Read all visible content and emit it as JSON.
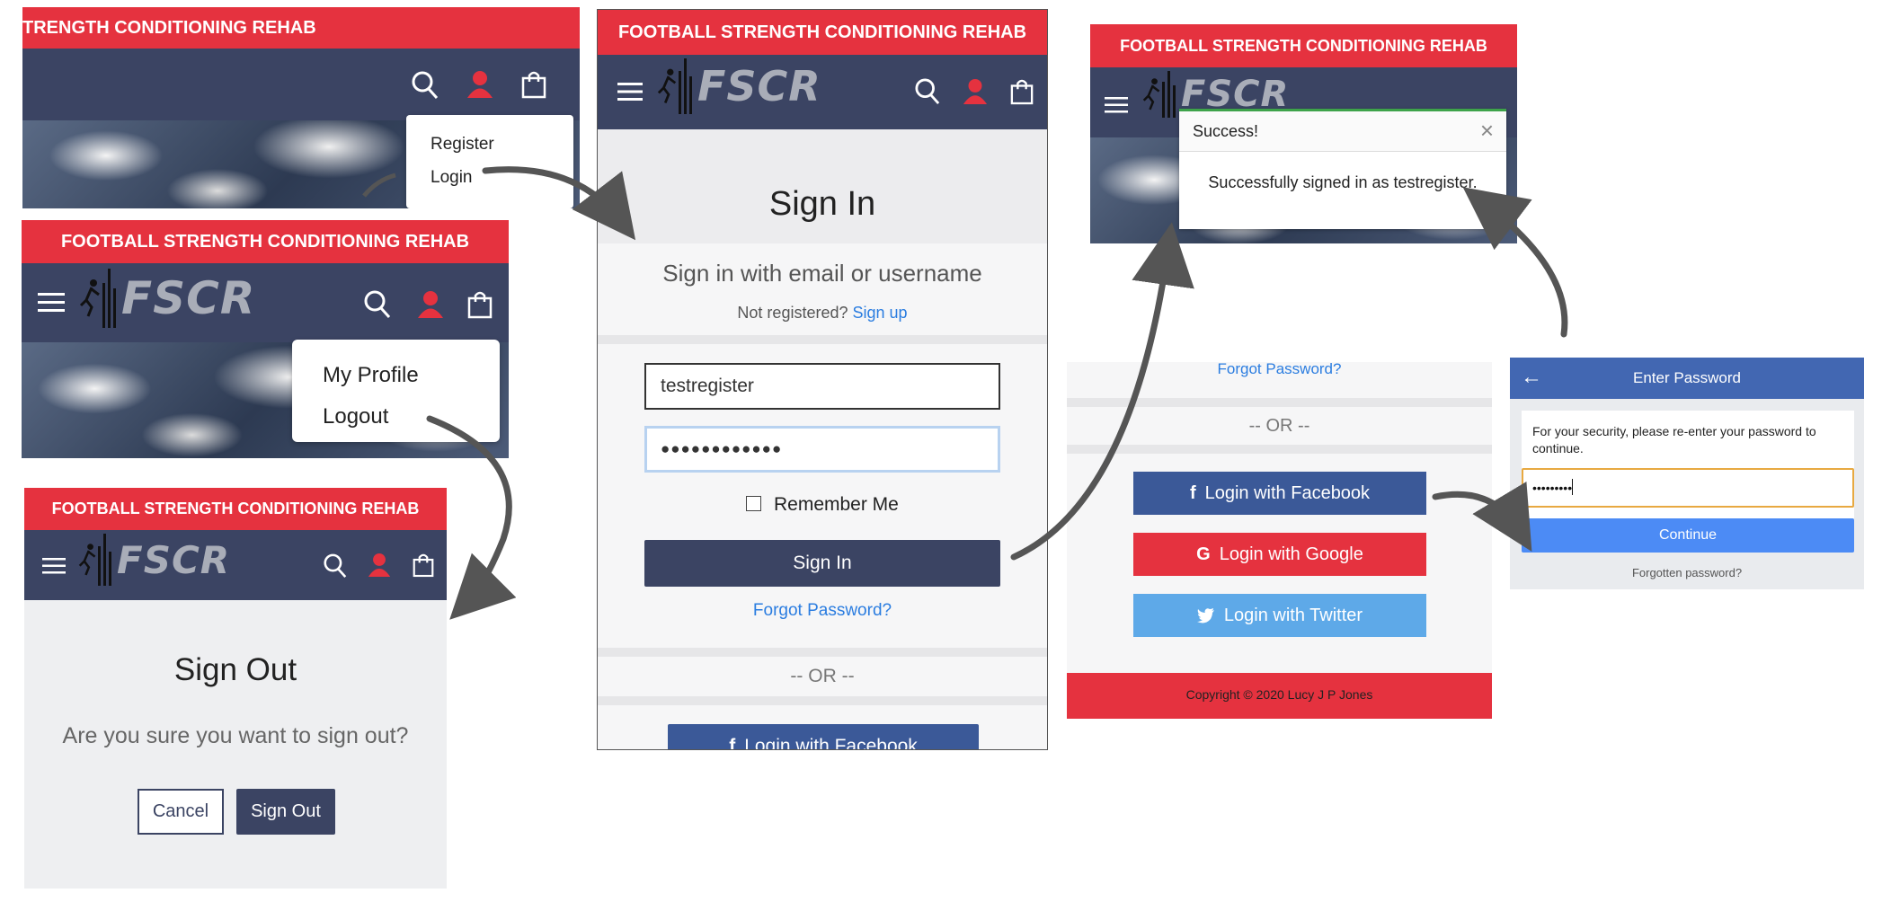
{
  "brand": {
    "banner_text": "FOOTBALL STRENGTH CONDITIONING REHAB",
    "banner_text_cropped": "TRENGTH CONDITIONING REHAB",
    "logo_text": "FSCR",
    "colors": {
      "red": "#e5323f",
      "navy": "#3b4463",
      "link": "#2b7de0",
      "facebook": "#3b5998",
      "twitter": "#5ea9e8"
    }
  },
  "icons": {
    "menu": "hamburger-icon",
    "search": "search-icon",
    "user": "user-icon",
    "bag": "shopping-bag-icon",
    "close": "close-icon",
    "back": "back-arrow-icon",
    "facebook": "facebook-icon",
    "google": "google-icon",
    "twitter": "twitter-icon"
  },
  "panel_account_menu": {
    "items": [
      "Register",
      "Login"
    ]
  },
  "panel_profile_menu": {
    "items": [
      "My Profile",
      "Logout"
    ]
  },
  "panel_signout": {
    "title": "Sign Out",
    "question": "Are you sure you want to sign out?",
    "cancel": "Cancel",
    "confirm": "Sign Out"
  },
  "panel_signin": {
    "title": "Sign In",
    "subtitle": "Sign in with email or username",
    "not_registered": "Not registered?",
    "signup": "Sign up",
    "username_value": "testregister",
    "password_value": "●●●●●●●●●●●●",
    "remember": "Remember Me",
    "submit": "Sign In",
    "forgot": "Forgot Password?",
    "or": "-- OR --",
    "facebook": "Login with Facebook"
  },
  "panel_success": {
    "heading": "Success!",
    "message": "Successfully signed in as testregister."
  },
  "panel_social": {
    "forgot": "Forgot Password?",
    "or": "-- OR --",
    "facebook": "Login with Facebook",
    "google": "Login with Google",
    "twitter": "Login with Twitter",
    "copyright": "Copyright © 2020 Lucy J P Jones"
  },
  "panel_fb_password": {
    "header": "Enter Password",
    "message": "For your security, please re-enter your password to continue.",
    "password_value": "•••••••••",
    "continue": "Continue",
    "forgotten": "Forgotten password?"
  }
}
